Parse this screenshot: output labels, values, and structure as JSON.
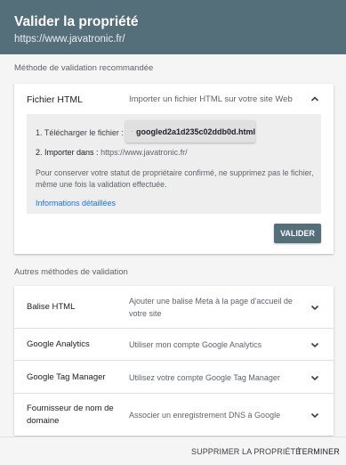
{
  "header": {
    "title": "Valider la propriété",
    "url": "https://www.javatronic.fr/"
  },
  "recommended": {
    "section_label": "Méthode de validation recommandée",
    "method_name": "Fichier HTML",
    "method_desc": "Importer un fichier HTML sur votre site Web",
    "step1_label": "1. Télécharger le fichier :",
    "download_file": "googled2a1d235c02ddb0d.html",
    "step2_label": "2. Importer dans :",
    "step2_value": "https://www.javatronic.fr/",
    "note": "Pour conserver votre statut de propriétaire confirmé, ne supprimez pas le fichier, même une fois la validation effectuée.",
    "more_link": "Informations détaillées",
    "verify_label": "VALIDER",
    "expanded_icon": "chevron-up-icon"
  },
  "other": {
    "section_label": "Autres méthodes de validation",
    "methods": [
      {
        "name": "Balise HTML",
        "desc": "Ajouter une balise Meta à la page d'accueil de votre site"
      },
      {
        "name": "Google Analytics",
        "desc": "Utiliser mon compte Google Analytics"
      },
      {
        "name": "Google Tag Manager",
        "desc": "Utilisez votre compte Google Tag Manager"
      },
      {
        "name": "Fournisseur de nom de domaine",
        "desc": "Associer un enregistrement DNS à Google"
      }
    ]
  },
  "footer": {
    "delete_label": "SUPPRIMER LA PROPRIÉTÉ",
    "done_label": "TERMINER"
  },
  "colors": {
    "header_bg": "#546e7a",
    "link": "#1a73e8",
    "verify_bg": "#546e7a"
  }
}
